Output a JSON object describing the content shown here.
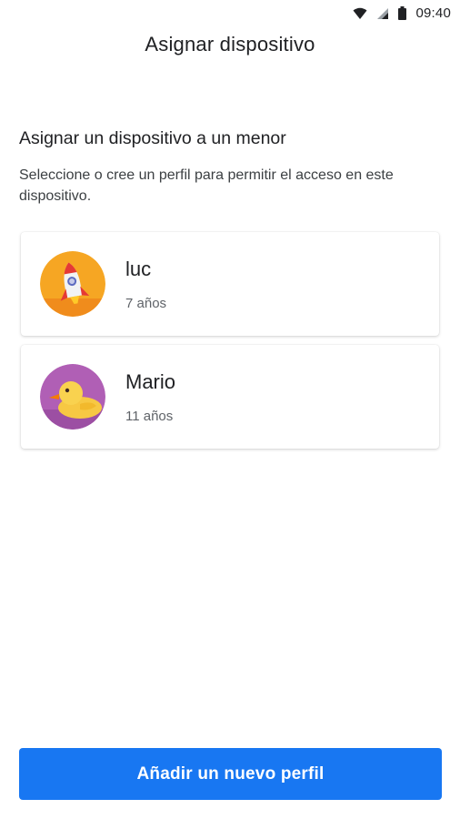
{
  "status_bar": {
    "time": "09:40",
    "icons": [
      "wifi-icon",
      "signal-icon",
      "battery-icon"
    ]
  },
  "app_bar": {
    "title": "Asignar dispositivo"
  },
  "main": {
    "heading": "Asignar un dispositivo a un menor",
    "description": "Seleccione o cree un perfil para permitir el acceso en este dispositivo.",
    "profiles": [
      {
        "name": "luc",
        "age": "7 años",
        "avatar": "rocket-avatar"
      },
      {
        "name": "Mario",
        "age": "11 años",
        "avatar": "duck-avatar"
      }
    ]
  },
  "footer": {
    "add_profile_label": "Añadir un nuevo perfil"
  },
  "colors": {
    "primary": "#1877f2",
    "rocket_bg": "#f6a623",
    "duck_bg": "#b05fb5",
    "duck_body": "#f7c843"
  }
}
